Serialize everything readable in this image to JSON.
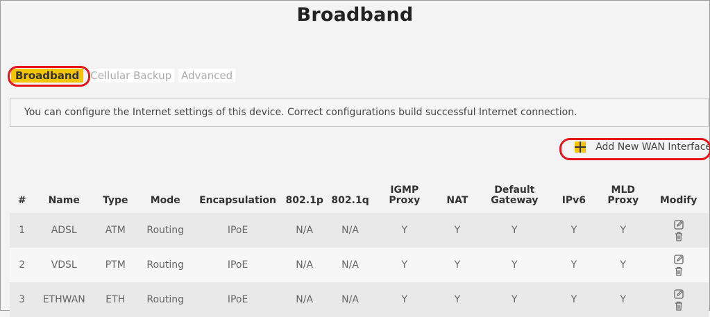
{
  "page": {
    "title": "Broadband"
  },
  "tabs": [
    {
      "label": "Broadband"
    },
    {
      "label": "Cellular Backup"
    },
    {
      "label": "Advanced"
    }
  ],
  "info": {
    "text": "You can configure the Internet settings of this device. Correct configurations build successful Internet connection."
  },
  "add_wan": {
    "label": "Add New WAN Interface",
    "icon": "plus-icon"
  },
  "colors": {
    "accent": "#f5c400",
    "highlight_ring": "#e8141c"
  },
  "table": {
    "headers": [
      "#",
      "Name",
      "Type",
      "Mode",
      "Encapsulation",
      "802.1p",
      "802.1q",
      "IGMP Proxy",
      "NAT",
      "Default Gateway",
      "IPv6",
      "MLD Proxy",
      "Modify"
    ],
    "rows": [
      [
        "1",
        "ADSL",
        "ATM",
        "Routing",
        "IPoE",
        "N/A",
        "N/A",
        "Y",
        "Y",
        "Y",
        "Y",
        "Y"
      ],
      [
        "2",
        "VDSL",
        "PTM",
        "Routing",
        "IPoE",
        "N/A",
        "N/A",
        "Y",
        "Y",
        "Y",
        "Y",
        "Y"
      ],
      [
        "3",
        "ETHWAN",
        "ETH",
        "Routing",
        "IPoE",
        "N/A",
        "N/A",
        "Y",
        "Y",
        "Y",
        "Y",
        "Y"
      ]
    ],
    "modify_icons": [
      "edit-icon",
      "trash-icon"
    ]
  }
}
